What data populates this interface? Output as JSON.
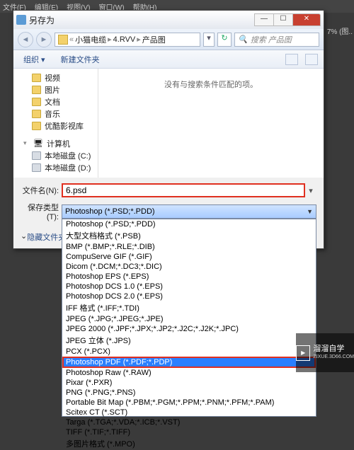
{
  "menubar": [
    "文件(F)",
    "编辑(E)",
    "视图(V)",
    "窗口(W)",
    "帮助(H)"
  ],
  "percent_overlay": "7% (图..",
  "dialog": {
    "title": "另存为",
    "breadcrumb": {
      "parts": [
        "小猫电缆",
        "4.RVV",
        "产品图"
      ]
    },
    "search_placeholder": "搜索 产品图",
    "toolbar": {
      "organize": "组织 ▾",
      "new_folder": "新建文件夹"
    },
    "sidebar": {
      "items": [
        {
          "label": "视频",
          "icon": "folder"
        },
        {
          "label": "图片",
          "icon": "folder"
        },
        {
          "label": "文档",
          "icon": "folder"
        },
        {
          "label": "音乐",
          "icon": "folder"
        },
        {
          "label": "优酷影视库",
          "icon": "folder"
        }
      ],
      "computer_header": "计算机",
      "drives": [
        {
          "label": "本地磁盘 (C:)"
        },
        {
          "label": "本地磁盘 (D:)"
        }
      ]
    },
    "content_empty": "没有与搜索条件匹配的项。",
    "filename_label": "文件名(N):",
    "filename_value": "6.psd",
    "filetype_label": "保存类型(T):",
    "filetype_value": "Photoshop (*.PSD;*.PDD)",
    "filetype_options": [
      "Photoshop (*.PSD;*.PDD)",
      "大型文档格式 (*.PSB)",
      "BMP (*.BMP;*.RLE;*.DIB)",
      "CompuServe GIF (*.GIF)",
      "Dicom (*.DCM;*.DC3;*.DIC)",
      "Photoshop EPS (*.EPS)",
      "Photoshop DCS 1.0 (*.EPS)",
      "Photoshop DCS 2.0 (*.EPS)",
      "IFF 格式 (*.IFF;*.TDI)",
      "JPEG (*.JPG;*.JPEG;*.JPE)",
      "JPEG 2000 (*.JPF;*.JPX;*.JP2;*.J2C;*.J2K;*.JPC)",
      "JPEG 立体 (*.JPS)",
      "PCX (*.PCX)",
      "Photoshop PDF (*.PDF;*.PDP)",
      "Photoshop Raw (*.RAW)",
      "Pixar (*.PXR)",
      "PNG (*.PNG;*.PNS)",
      "Portable Bit Map (*.PBM;*.PGM;*.PPM;*.PNM;*.PFM;*.PAM)",
      "Scitex CT (*.SCT)",
      "Targa (*.TGA;*.VDA;*.ICB;*.VST)",
      "TIFF (*.TIF;*.TIFF)",
      "多图片格式 (*.MPO)"
    ],
    "selected_option_index": 13,
    "hide_folders": "隐藏文件夹"
  },
  "watermark": {
    "logo_text": "zixue",
    "title": "溜溜自学",
    "url": "ZIXUE.3D66.COM"
  }
}
